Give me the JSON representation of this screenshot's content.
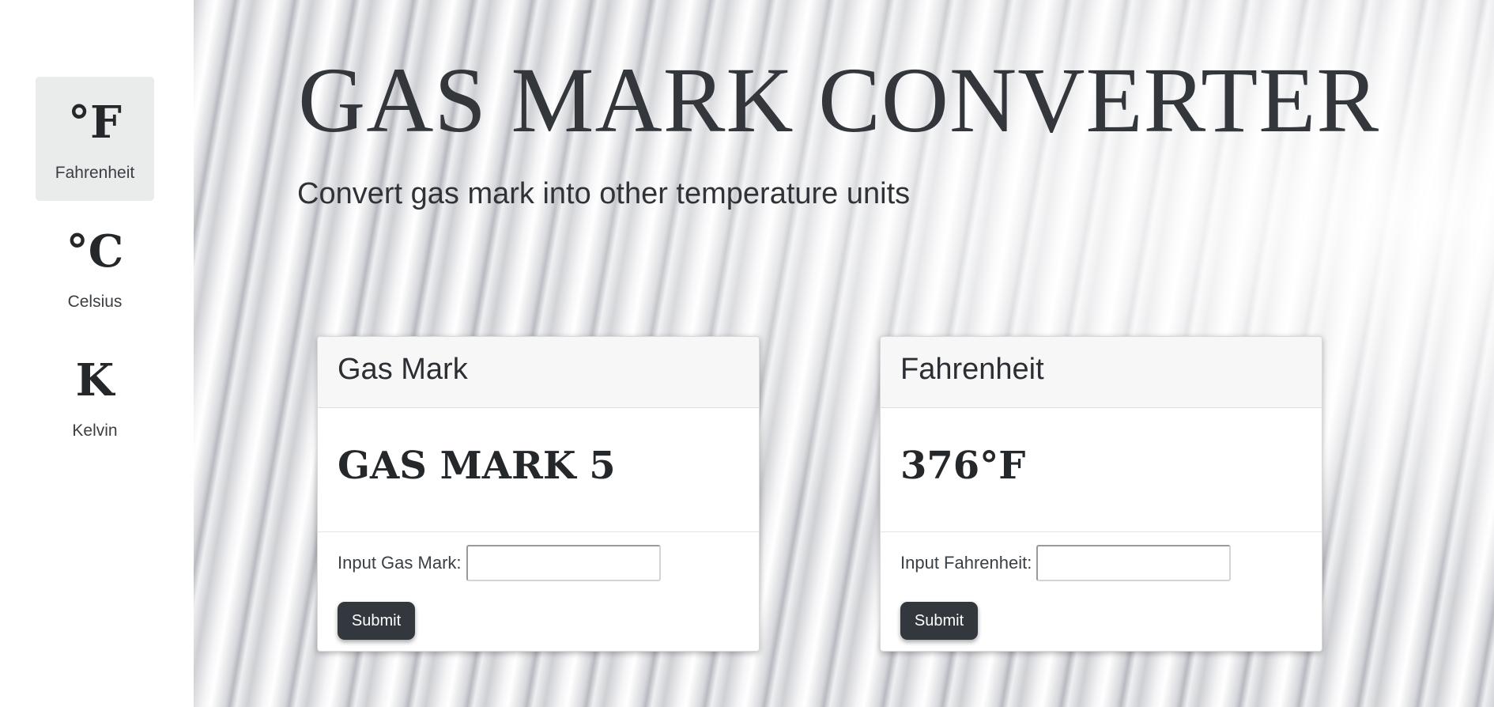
{
  "sidebar": {
    "items": [
      {
        "symbol": "°F",
        "label": "Fahrenheit",
        "active": true
      },
      {
        "symbol": "°C",
        "label": "Celsius",
        "active": false
      },
      {
        "symbol": "K",
        "label": "Kelvin",
        "active": false
      }
    ]
  },
  "hero": {
    "title": "GAS MARK CONVERTER",
    "subtitle": "Convert gas mark into other temperature units"
  },
  "cards": {
    "gas_mark": {
      "header": "Gas Mark",
      "value": "GAS MARK 5",
      "input_label": "Input Gas Mark:",
      "input_value": "",
      "submit_label": "Submit"
    },
    "fahrenheit": {
      "header": "Fahrenheit",
      "value": "376°F",
      "input_label": "Input Fahrenheit:",
      "input_value": "",
      "submit_label": "Submit"
    }
  },
  "colors": {
    "accent_button": "#33373e",
    "active_nav_bg": "#eaebeb",
    "text_dark": "#2b2f33"
  }
}
